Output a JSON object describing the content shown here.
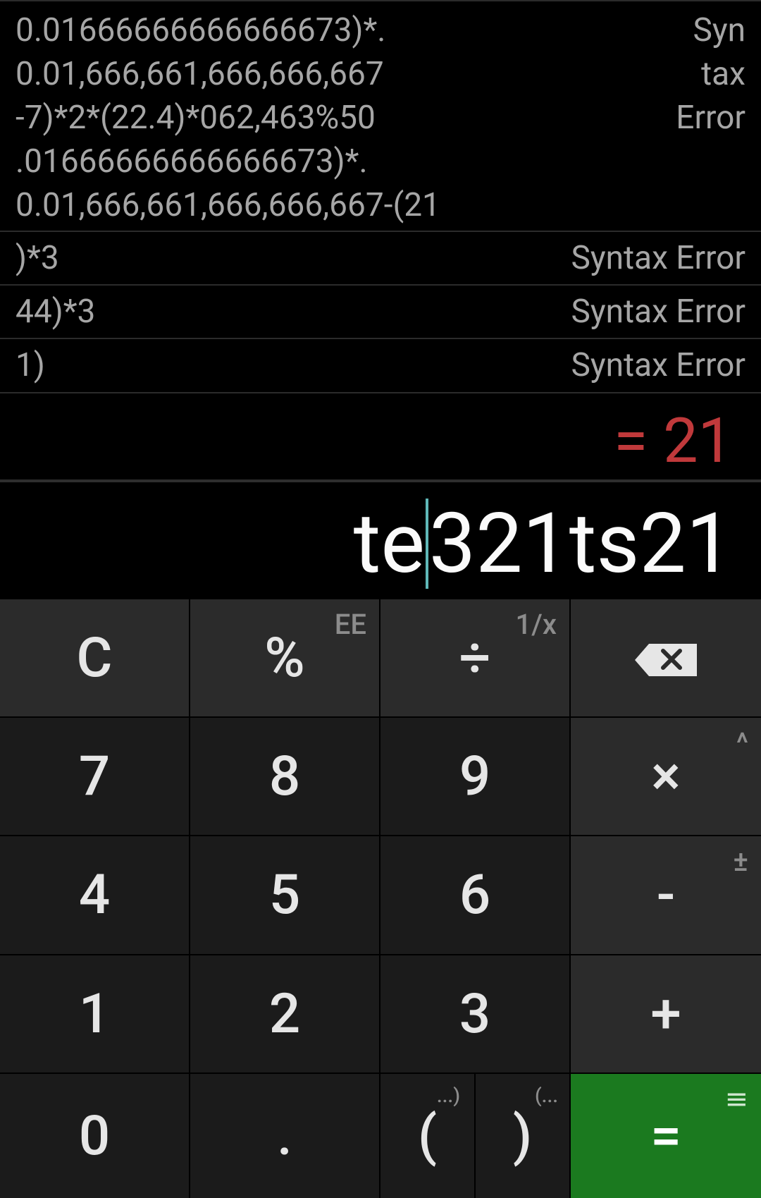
{
  "history": [
    {
      "expression": "0.01666666666666673)*.\n0.01,666,661,666,666,667\n-7)*2*(22.4)*062,463%50\n.01666666666666673)*.\n0.01,666,661,666,666,667-(21",
      "result": "Syn\ntax\nError"
    },
    {
      "expression": ")*3",
      "result": "Syntax Error"
    },
    {
      "expression": "44)*3",
      "result": "Syntax Error"
    },
    {
      "expression": "1)",
      "result": "Syntax Error"
    }
  ],
  "live_result": "= 21",
  "display": {
    "before_cursor": "te",
    "after_cursor": "321ts21"
  },
  "keys": {
    "clear": "C",
    "percent": "%",
    "percent_alt": "EE",
    "divide": "÷",
    "divide_alt": "1/x",
    "backspace_icon": "backspace-icon",
    "seven": "7",
    "eight": "8",
    "nine": "9",
    "multiply": "×",
    "multiply_alt": "^",
    "four": "4",
    "five": "5",
    "six": "6",
    "minus": "-",
    "minus_alt": "±",
    "one": "1",
    "two": "2",
    "three": "3",
    "plus": "+",
    "zero": "0",
    "decimal": ".",
    "open_paren": "(",
    "open_paren_alt": "...)",
    "close_paren": ")",
    "close_paren_alt": "(...",
    "equals": "=",
    "equals_alt": "≡"
  },
  "colors": {
    "live_result": "#c0393b",
    "equals_key": "#1b7a1f",
    "cursor": "#5fb8b8"
  }
}
